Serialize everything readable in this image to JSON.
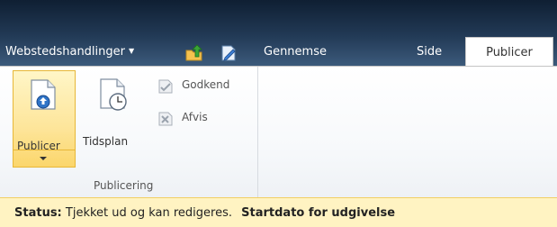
{
  "topnav": {
    "site_actions_label": "Webstedshandlinger",
    "tabs": [
      {
        "label": "Gennemse"
      },
      {
        "label": "Side"
      },
      {
        "label": "Publicer",
        "active": true
      }
    ]
  },
  "ribbon": {
    "group": {
      "label": "Publicering",
      "buttons": {
        "publish": "Publicer",
        "schedule": "Tidsplan",
        "approve": "Godkend",
        "reject": "Afvis"
      }
    }
  },
  "status": {
    "label": "Status:",
    "text": "Tjekket ud og kan redigeres.",
    "next_label": "Startdato for udgivelse"
  },
  "icons": [
    "dropdown-caret-icon",
    "navigate-up-icon",
    "edit-page-icon",
    "publish-page-icon",
    "schedule-clock-icon",
    "approve-icon",
    "reject-icon"
  ],
  "colors": {
    "topbar": "#1b3048",
    "active_tab": "#ffffff",
    "publish_button_highlight": "#fde59a",
    "status_bar": "#fff3c2"
  }
}
